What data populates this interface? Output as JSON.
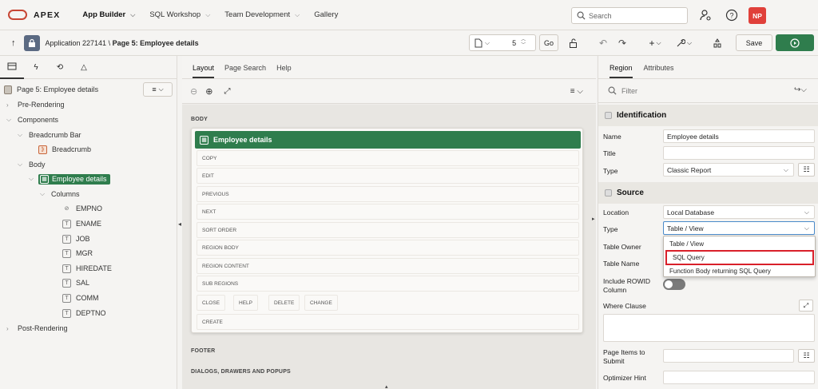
{
  "header": {
    "brand": "APEX",
    "nav": [
      {
        "label": "App Builder"
      },
      {
        "label": "SQL Workshop"
      },
      {
        "label": "Team Development"
      },
      {
        "label": "Gallery"
      }
    ],
    "search_placeholder": "Search",
    "avatar_initials": "NP"
  },
  "toolbar": {
    "app_label": "Application 227141",
    "separator": "\\",
    "page_label": "Page 5: Employee details",
    "page_number": "5",
    "go_label": "Go",
    "save_label": "Save"
  },
  "left": {
    "page_node": "Page 5: Employee details",
    "tree": {
      "pre_rendering": "Pre-Rendering",
      "components": "Components",
      "breadcrumb_bar": "Breadcrumb Bar",
      "breadcrumb": "Breadcrumb",
      "body": "Body",
      "employee_details": "Employee details",
      "columns": "Columns",
      "cols": [
        "EMPNO",
        "ENAME",
        "JOB",
        "MGR",
        "HIREDATE",
        "SAL",
        "COMM",
        "DEPTNO"
      ],
      "post_rendering": "Post-Rendering"
    }
  },
  "center": {
    "tabs": [
      "Layout",
      "Page Search",
      "Help"
    ],
    "body_label": "BODY",
    "region_title": "Employee details",
    "slots": [
      "COPY",
      "EDIT",
      "PREVIOUS",
      "NEXT",
      "SORT ORDER",
      "REGION BODY",
      "REGION CONTENT",
      "SUB REGIONS"
    ],
    "button_slots": [
      "CLOSE",
      "HELP",
      "DELETE",
      "CHANGE"
    ],
    "create_slot": "CREATE",
    "footer_label": "FOOTER",
    "dialogs_label": "DIALOGS, DRAWERS AND POPUPS"
  },
  "right": {
    "tabs": [
      "Region",
      "Attributes"
    ],
    "filter_placeholder": "Filter",
    "identification": "Identification",
    "name_label": "Name",
    "name_value": "Employee details",
    "title_label": "Title",
    "type_label": "Type",
    "type_value": "Classic Report",
    "source": "Source",
    "location_label": "Location",
    "location_value": "Local Database",
    "src_type_label": "Type",
    "src_type_value": "Table / View",
    "table_owner_label": "Table Owner",
    "table_name_label": "Table Name",
    "include_rowid_label": "Include ROWID Column",
    "where_clause_label": "Where Clause",
    "page_items_label": "Page Items to Submit",
    "optimizer_hint_label": "Optimizer Hint",
    "dropdown_options": [
      "Table / View",
      "SQL Query",
      "Function Body returning SQL Query"
    ]
  }
}
